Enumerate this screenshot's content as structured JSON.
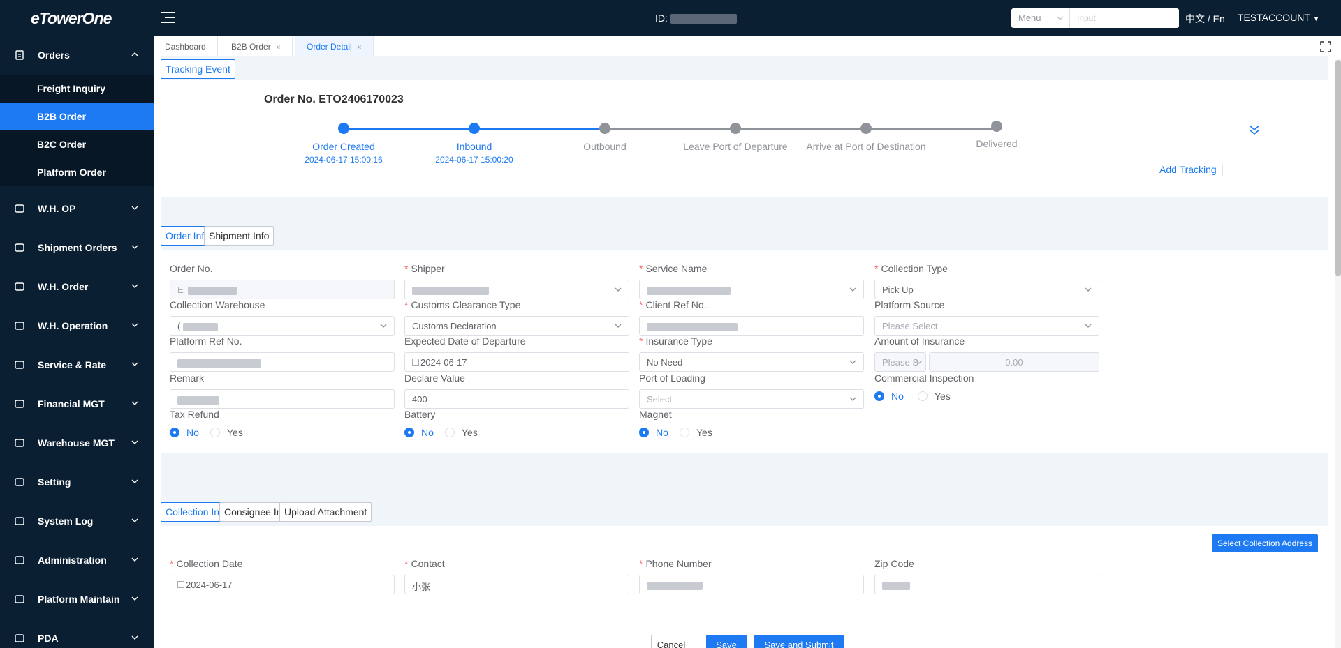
{
  "app": {
    "logo": "eTowerOne",
    "id_label": "ID:",
    "search_select": "Menu",
    "search_placeholder": "Input",
    "language": "中文 / En",
    "account": "TESTACCOUNT"
  },
  "sidebar": {
    "orders": {
      "label": "Orders",
      "items": [
        "Freight Inquiry",
        "B2B Order",
        "B2C Order",
        "Platform Order"
      ]
    },
    "groups": [
      "W.H. OP",
      "Shipment Orders",
      "W.H. Order",
      "W.H. Operation",
      "Service & Rate",
      "Financial MGT",
      "Warehouse MGT",
      "Setting",
      "System Log",
      "Administration",
      "Platform Maintain",
      "PDA"
    ]
  },
  "tabs": [
    "Dashboard",
    "B2B Order",
    "Order Detail"
  ],
  "tracking": {
    "button": "Tracking Event",
    "order_no": "Order No. ETO2406170023",
    "steps": [
      {
        "label": "Order Created",
        "date": "2024-06-17 15:00:16",
        "done": true
      },
      {
        "label": "Inbound",
        "date": "2024-06-17 15:00:20",
        "done": true
      },
      {
        "label": "Outbound",
        "date": "",
        "done": false
      },
      {
        "label": "Leave Port of Departure",
        "date": "",
        "done": false
      },
      {
        "label": "Arrive at Port of Destination",
        "date": "",
        "done": false
      },
      {
        "label": "Delivered",
        "date": "",
        "done": false
      }
    ],
    "add_tracking": "Add Tracking"
  },
  "info_tabs": {
    "order_info": "Order Info",
    "shipment_info": "Shipment Info"
  },
  "order_info": {
    "order_no": {
      "label": "Order No.",
      "value": "E"
    },
    "shipper": {
      "label": "Shipper",
      "value": ""
    },
    "service_name": {
      "label": "Service Name",
      "value": ""
    },
    "collection_type": {
      "label": "Collection Type",
      "value": "Pick Up"
    },
    "collection_warehouse": {
      "label": "Collection Warehouse",
      "value": "("
    },
    "customs_clearance_type": {
      "label": "Customs Clearance Type",
      "value": "Customs Declaration"
    },
    "client_ref_no": {
      "label": "Client Ref No..",
      "value": ""
    },
    "platform_source": {
      "label": "Platform Source",
      "placeholder": "Please Select"
    },
    "platform_ref_no": {
      "label": "Platform Ref No.",
      "value": ""
    },
    "expected_departure": {
      "label": "Expected Date of Departure",
      "value": "2024-06-17"
    },
    "insurance_type": {
      "label": "Insurance Type",
      "value": "No Need"
    },
    "amount_of_insurance": {
      "label": "Amount of Insurance",
      "currency_placeholder": "Please S",
      "value": "0.00"
    },
    "remark": {
      "label": "Remark",
      "value": ""
    },
    "declare_value": {
      "label": "Declare Value",
      "value": "400"
    },
    "port_of_loading": {
      "label": "Port of Loading",
      "placeholder": "Select"
    },
    "commercial_inspection": {
      "label": "Commercial Inspection",
      "options": [
        "No",
        "Yes"
      ],
      "selected": "No"
    },
    "tax_refund": {
      "label": "Tax Refund",
      "options": [
        "No",
        "Yes"
      ],
      "selected": "No"
    },
    "battery": {
      "label": "Battery",
      "options": [
        "No",
        "Yes"
      ],
      "selected": "No"
    },
    "magnet": {
      "label": "Magnet",
      "options": [
        "No",
        "Yes"
      ],
      "selected": "No"
    }
  },
  "collection_tabs": {
    "collection_info": "Collection Info",
    "consignee_info": "Consignee Info",
    "upload_attachment": "Upload Attachment"
  },
  "collection": {
    "select_address": "Select Collection Address",
    "collection_date": {
      "label": "Collection Date",
      "value": "2024-06-17"
    },
    "contact": {
      "label": "Contact",
      "value": "小张"
    },
    "phone_number": {
      "label": "Phone Number",
      "value": ""
    },
    "zip_code": {
      "label": "Zip Code",
      "value": ""
    }
  },
  "footer": {
    "cancel": "Cancel",
    "save": "Save",
    "save_submit": "Save and Submit"
  },
  "colors": {
    "primary": "#1d7af2",
    "sidebar": "#0b1f33",
    "required": "#f56c6c",
    "pending": "#909399"
  }
}
